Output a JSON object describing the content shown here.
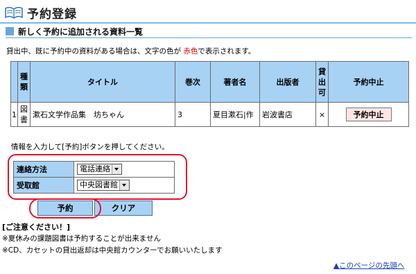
{
  "header": {
    "title": "予約登録"
  },
  "section": {
    "title": "新しく予約に追加される資料一覧"
  },
  "notice": {
    "before": "貸出中、既に予約中の資料がある場合は、文字の色が",
    "red_word": "赤色",
    "after": "で表示されます。"
  },
  "table": {
    "headers": {
      "type": "種類",
      "title": "タイトル",
      "volume": "巻次",
      "author": "著者名",
      "publisher": "出版者",
      "lendable": "貸出可",
      "cancel": "予約中止"
    },
    "rows": [
      {
        "num": "1",
        "type": "図書",
        "title": "漱石文学作品集　坊ちゃん",
        "volume": "3",
        "author": "夏目漱石|作",
        "publisher": "岩波書店",
        "lendable": "×",
        "cancel_label": "予約中止"
      }
    ]
  },
  "instruction": "情報を入力して[予約]ボタンを押してください。",
  "form": {
    "contact_label": "連絡方法",
    "contact_value": "電話連絡",
    "library_label": "受取館",
    "library_value": "中央図書館"
  },
  "buttons": {
    "reserve": "予約",
    "clear": "クリア"
  },
  "caution": {
    "title": "[ご注意ください！]",
    "note1": "※夏休みの課題図書は予約することが出来ません",
    "note2": "※CD、カセットの貸出返却は中央館カウンターでお願いいたします"
  },
  "footer": {
    "page_top": "▲このページの先頭へ"
  },
  "colors": {
    "accent": "#a8d2f4",
    "highlight": "#e8102a",
    "section": "#6aa6dc"
  }
}
